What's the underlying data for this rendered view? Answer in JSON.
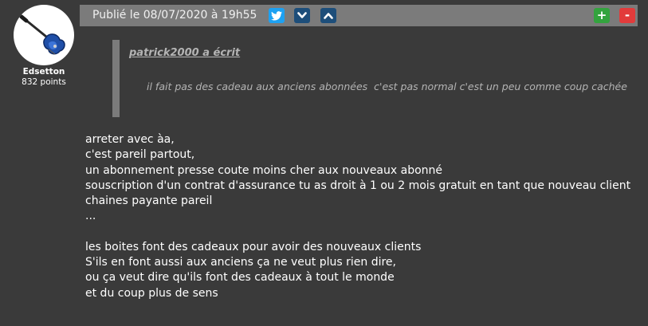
{
  "author": {
    "name": "Edsetton",
    "points": "832 points"
  },
  "header": {
    "published": "Publié le 08/07/2020 à 19h55",
    "plus_label": "+",
    "minus_label": "-"
  },
  "icons": {
    "twitter": "twitter-icon",
    "down": "chevron-down-icon",
    "up": "chevron-up-icon"
  },
  "colors": {
    "background": "#3a3a3a",
    "header_bar": "#7b7b7b",
    "twitter": "#1da1f2",
    "nav_button": "#1d4e7a",
    "plus": "#33a33e",
    "minus": "#e23b3b",
    "quote_text": "#b4b4b4"
  },
  "quote": {
    "author_line": "patrick2000 a écrit",
    "text": "il fait pas des cadeau aux anciens abonnées  c'est pas normal c'est un peu comme coup cachée"
  },
  "body": {
    "paragraph1": [
      "arreter avec àa,",
      "c'est pareil partout,",
      "un abonnement presse coute moins cher aux nouveaux abonné",
      "souscription d'un contrat d'assurance tu as droit à 1 ou 2 mois gratuit en tant que nouveau client",
      "chaines payante pareil",
      "..."
    ],
    "paragraph2": [
      "les boites font des cadeaux pour avoir des nouveaux clients",
      "S'ils en font aussi aux anciens ça ne veut plus rien dire,",
      "ou ça veut dire qu'ils font des cadeaux à tout le monde",
      "et du coup plus de sens"
    ]
  }
}
